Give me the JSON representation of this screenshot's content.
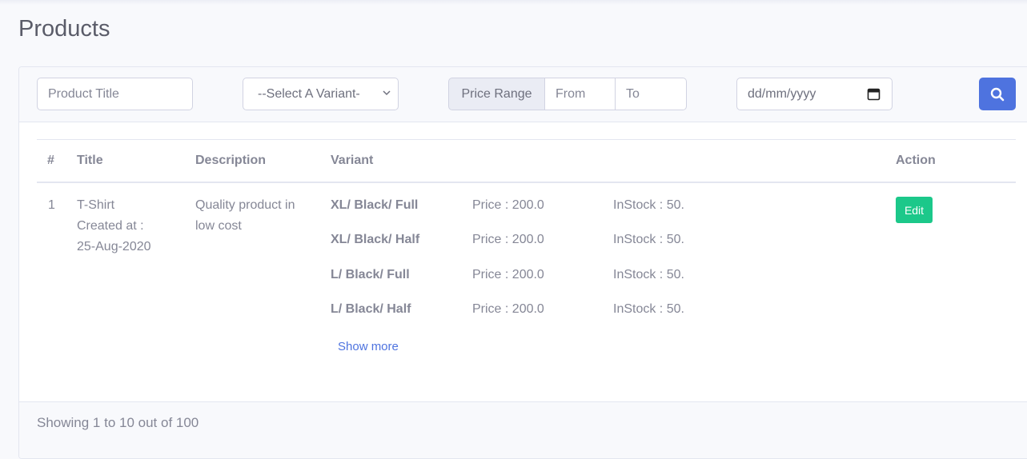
{
  "page": {
    "title": "Products"
  },
  "filters": {
    "title_placeholder": "Product Title",
    "variant_selected": "--Select A Variant-",
    "price_range_label": "Price Range",
    "price_from_placeholder": "From",
    "price_to_placeholder": "To",
    "date_placeholder": "dd/mm/yyyy",
    "search_icon": "search-icon",
    "accent_color": "#4e73df"
  },
  "table": {
    "headers": {
      "num": "#",
      "title": "Title",
      "description": "Description",
      "variant": "Variant",
      "action": "Action"
    },
    "rows": [
      {
        "num": "1",
        "title": "T-Shirt",
        "created_label": "Created at :",
        "created_date": "25-Aug-2020",
        "description": "Quality product in low cost",
        "variants": [
          {
            "name": "XL/ Black/ Full",
            "price": "Price : 200.0",
            "stock": "InStock : 50."
          },
          {
            "name": "XL/ Black/ Half",
            "price": "Price : 200.0",
            "stock": "InStock : 50."
          },
          {
            "name": "L/ Black/ Full",
            "price": "Price : 200.0",
            "stock": "InStock : 50."
          },
          {
            "name": "L/ Black/ Half",
            "price": "Price : 200.0",
            "stock": "InStock : 50."
          }
        ],
        "show_more": "Show more",
        "edit_label": "Edit",
        "edit_color": "#1cc88a"
      }
    ]
  },
  "footer": {
    "summary": "Showing 1 to 10 out of 100"
  }
}
